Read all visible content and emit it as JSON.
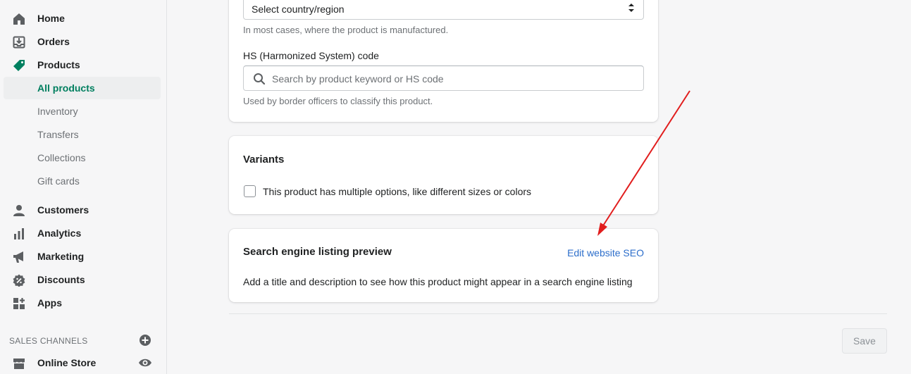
{
  "sidebar": {
    "items": [
      {
        "label": "Home",
        "icon": "home-icon"
      },
      {
        "label": "Orders",
        "icon": "orders-icon"
      },
      {
        "label": "Products",
        "icon": "tag-icon"
      },
      {
        "label": "All products"
      },
      {
        "label": "Inventory"
      },
      {
        "label": "Transfers"
      },
      {
        "label": "Collections"
      },
      {
        "label": "Gift cards"
      },
      {
        "label": "Customers",
        "icon": "person-icon"
      },
      {
        "label": "Analytics",
        "icon": "bar-chart-icon"
      },
      {
        "label": "Marketing",
        "icon": "megaphone-icon"
      },
      {
        "label": "Discounts",
        "icon": "discount-icon"
      },
      {
        "label": "Apps",
        "icon": "apps-icon"
      }
    ],
    "sales_channels_header": "SALES CHANNELS",
    "online_store": "Online Store"
  },
  "customs": {
    "country_value": "Select country/region",
    "country_help": "In most cases, where the product is manufactured.",
    "hs_label": "HS (Harmonized System) code",
    "hs_placeholder": "Search by product keyword or HS code",
    "hs_help": "Used by border officers to classify this product."
  },
  "variants": {
    "title": "Variants",
    "checkbox_label": "This product has multiple options, like different sizes or colors"
  },
  "seo": {
    "title": "Search engine listing preview",
    "edit_link": "Edit website SEO",
    "description": "Add a title and description to see how this product might appear in a search engine listing"
  },
  "footer": {
    "save_label": "Save"
  },
  "colors": {
    "accent_green": "#007f5f",
    "link_blue": "#2c6ecb",
    "annotation_red": "#e11d1d"
  }
}
